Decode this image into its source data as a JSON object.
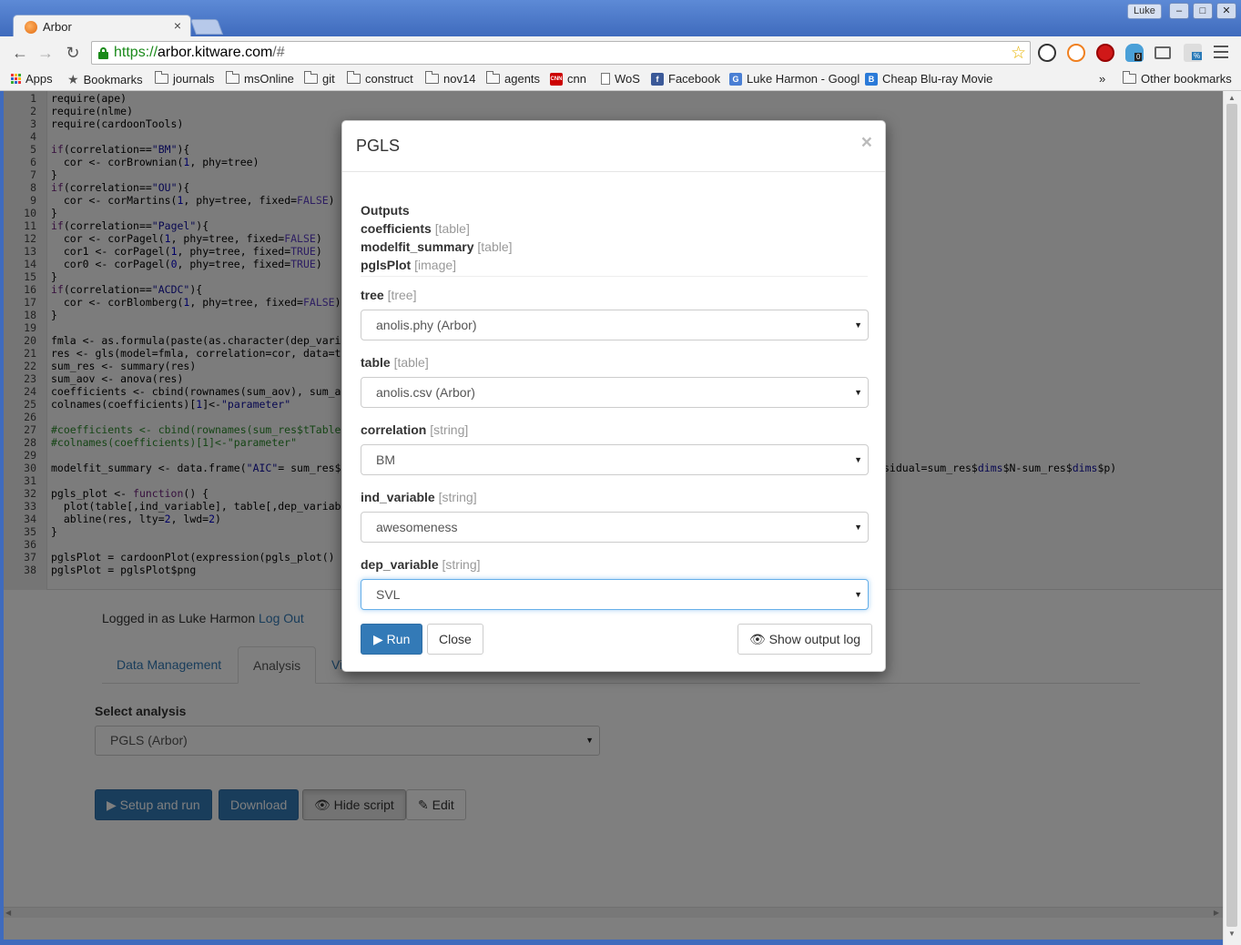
{
  "browser": {
    "tab_title": "Arbor",
    "tab_close": "×",
    "profile_name": "Luke",
    "window_buttons": [
      "–",
      "□",
      "✕"
    ],
    "url_scheme": "https://",
    "url_host": "arbor.kitware.com",
    "url_path": "/#",
    "extension_badges": [
      "0",
      "%"
    ],
    "bookmarks": [
      {
        "label": "Apps",
        "icon": "apps-grid-icon"
      },
      {
        "label": "Bookmarks",
        "icon": "star-icon"
      },
      {
        "label": "journals",
        "icon": "folder-icon"
      },
      {
        "label": "msOnline",
        "icon": "folder-icon"
      },
      {
        "label": "git",
        "icon": "folder-icon"
      },
      {
        "label": "construct",
        "icon": "folder-icon"
      },
      {
        "label": "nov14",
        "icon": "folder-icon"
      },
      {
        "label": "agents",
        "icon": "folder-icon"
      },
      {
        "label": "cnn",
        "icon": "cnn-icon"
      },
      {
        "label": "WoS",
        "icon": "page-icon"
      },
      {
        "label": "Facebook",
        "icon": "facebook-icon"
      },
      {
        "label": "Luke Harmon - Googl",
        "icon": "google-scholar-icon"
      },
      {
        "label": "Cheap Blu-ray Movie",
        "icon": "blu-ray-icon"
      }
    ],
    "bookmarks_overflow": "»",
    "other_bookmarks": "Other bookmarks"
  },
  "editor": {
    "lines": [
      "require(ape)",
      "require(nlme)",
      "require(cardoonTools)",
      "",
      "if(correlation==\"BM\"){",
      "  cor <- corBrownian(1, phy=tree)",
      "}",
      "if(correlation==\"OU\"){",
      "  cor <- corMartins(1, phy=tree, fixed=FALSE)",
      "}",
      "if(correlation==\"Pagel\"){",
      "  cor <- corPagel(1, phy=tree, fixed=FALSE)",
      "  cor1 <- corPagel(1, phy=tree, fixed=TRUE)",
      "  cor0 <- corPagel(0, phy=tree, fixed=TRUE)",
      "}",
      "if(correlation==\"ACDC\"){",
      "  cor <- corBlomberg(1, phy=tree, fixed=FALSE)",
      "}",
      "",
      "fmla <- as.formula(paste(as.character(dep_vari",
      "res <- gls(model=fmla, correlation=cor, data=t",
      "sum_res <- summary(res)",
      "sum_aov <- anova(res)",
      "coefficients <- cbind(rownames(sum_aov), sum_a",
      "colnames(coefficients)[1]<-\"parameter\"",
      "",
      "#coefficients <- cbind(rownames(sum_res$tTable",
      "#colnames(coefficients)[1]<-\"parameter\"",
      "",
      "modelfit_summary <- data.frame(\"AIC\"= sum_res$",
      "",
      "pgls_plot <- function() {",
      "  plot(table[,ind_variable], table[,dep_variab",
      "  abline(res, lty=2, lwd=2)",
      "}",
      "",
      "pglsPlot = cardoonPlot(expression(pgls_plot()",
      "pglsPlot = pglsPlot$png"
    ],
    "line30_tail": "sidual=sum_res$dims$N-sum_res$dims$p)"
  },
  "app": {
    "login_prefix": "Logged in as Luke Harmon",
    "logout_link": "Log Out",
    "tabs": [
      {
        "label": "Data Management",
        "active": false
      },
      {
        "label": "Analysis",
        "active": true
      },
      {
        "label": "Vi",
        "active": false
      }
    ],
    "select_analysis_label": "Select analysis",
    "select_analysis_value": "PGLS (Arbor)",
    "buttons": {
      "setup_run": "Setup and run",
      "download": "Download",
      "hide_script": "Hide script",
      "edit": "Edit"
    }
  },
  "modal": {
    "title": "PGLS",
    "close": "×",
    "outputs_heading": "Outputs",
    "outputs": [
      {
        "name": "coefficients",
        "type": "[table]"
      },
      {
        "name": "modelfit_summary",
        "type": "[table]"
      },
      {
        "name": "pglsPlot",
        "type": "[image]"
      }
    ],
    "fields": [
      {
        "name": "tree",
        "type": "[tree]",
        "value": "anolis.phy (Arbor)"
      },
      {
        "name": "table",
        "type": "[table]",
        "value": "anolis.csv (Arbor)"
      },
      {
        "name": "correlation",
        "type": "[string]",
        "value": "BM"
      },
      {
        "name": "ind_variable",
        "type": "[string]",
        "value": "awesomeness"
      },
      {
        "name": "dep_variable",
        "type": "[string]",
        "value": "SVL"
      }
    ],
    "run_label": "Run",
    "close_label": "Close",
    "show_log_label": "Show output log"
  },
  "colors": {
    "primary": "#337ab7",
    "chrome_blue": "#4c7ac8",
    "link": "#337ab7"
  }
}
